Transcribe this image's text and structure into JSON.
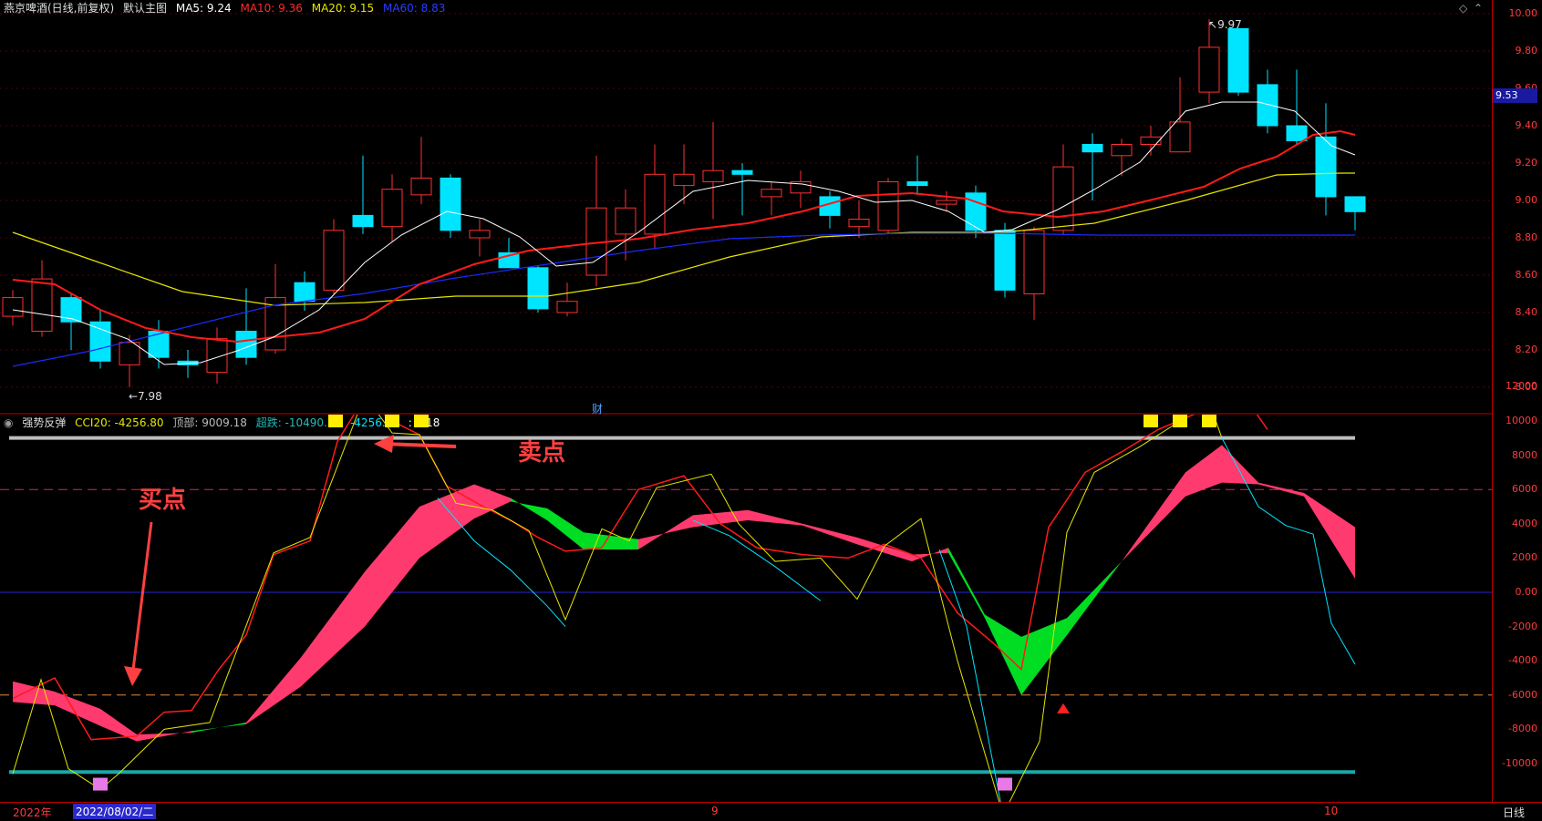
{
  "main": {
    "stock_name": "燕京啤酒(日线,前复权)",
    "indicator_name": "默认主图",
    "ma5": "MA5: 9.24",
    "ma10": "MA10: 9.36",
    "ma20": "MA20: 9.15",
    "ma60": "MA60: 8.83",
    "high_mark": "9.97",
    "low_mark": "←7.98",
    "finance_mark": "财",
    "current_price": "9.53",
    "y_ticks": [
      "10.00",
      "9.80",
      "9.60",
      "9.40",
      "9.20",
      "9.00",
      "8.80",
      "8.60",
      "8.40",
      "8.20",
      "8.00"
    ]
  },
  "sub": {
    "indicator_name": "强势反弹",
    "cci": "CCI20: -4256.80",
    "top": "顶部: 9009.18",
    "over_fall": "超跌: -10490.82",
    "value2": "-4256.80",
    "value3": ": 9.18",
    "y_ticks": [
      "12000",
      "10000",
      "8000",
      "6000",
      "4000",
      "2000",
      "0.00",
      "-2000",
      "-4000",
      "-6000",
      "-8000",
      "-10000"
    ],
    "sell_label": "卖点",
    "buy_label": "买点"
  },
  "footer": {
    "year_label": "2022年",
    "date_label": "2022/08/02/二",
    "month9": "9",
    "month10": "10",
    "period": "日线"
  },
  "colors": {
    "up": "#ff3030",
    "down": "#00e5ff",
    "ma5": "#ffffff",
    "ma10": "#ff1a1a",
    "ma20": "#e6e600",
    "ma60": "#1a2bff",
    "pink_band": "#ff3a6e",
    "green_band": "#00dd22"
  }
}
